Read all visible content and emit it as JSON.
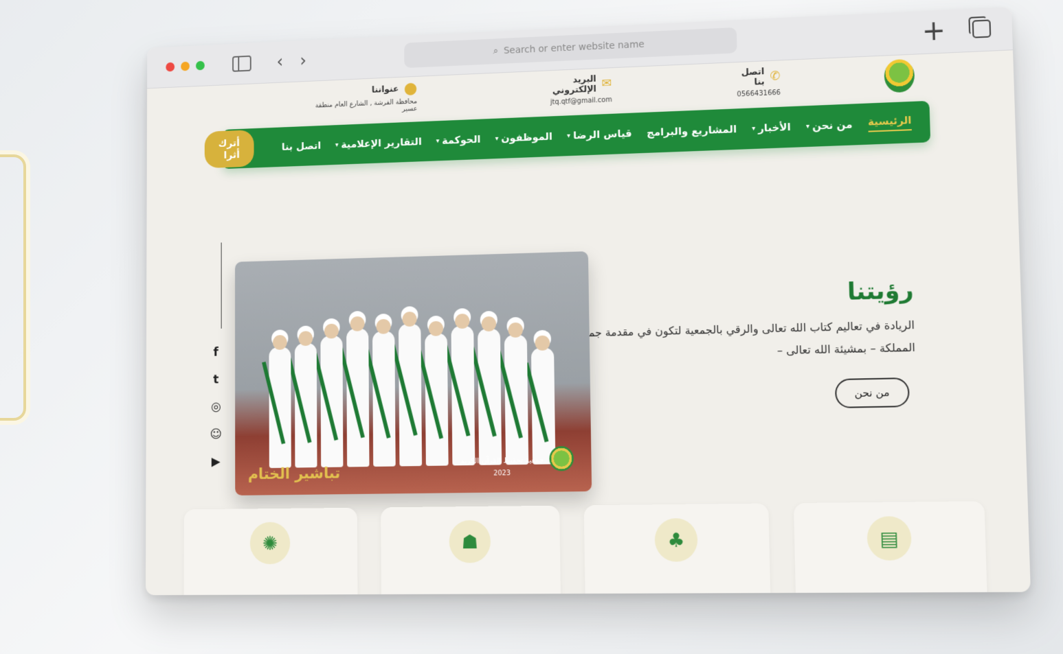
{
  "browser": {
    "address_placeholder": "Search or enter website name"
  },
  "topbar": {
    "address_label": "عنواننا",
    "address_value": "محافظة الفرشة , الشارع العام منطقة عسير",
    "email_label": "البريد الإلكتروني",
    "email_value": "jtq.qtf@gmail.com",
    "phone_label": "اتصل بنا",
    "phone_value": "0566431666"
  },
  "nav": {
    "items": [
      {
        "label": "الرئيسية"
      },
      {
        "label": "من نحن"
      },
      {
        "label": "الأخبار"
      },
      {
        "label": "المشاريع والبرامج"
      },
      {
        "label": "قياس الرضا"
      },
      {
        "label": "الموظفون"
      },
      {
        "label": "الحوكمة"
      },
      {
        "label": "التقارير الإعلامية"
      },
      {
        "label": "اتصل بنا"
      }
    ],
    "cta": "أترك أثرا"
  },
  "hero": {
    "title": "رؤيتنا",
    "text": "الريادة في تعاليم كتاب الله تعالى والرقي بالجمعية لتكون في مقدمة جمعيات المملكة – بمشيئة الله تعالى –",
    "button": "من نحن",
    "photo_caption": "تباشير الختام",
    "photo_association": "جمعية تحفيظ القرآن الكريم",
    "photo_year": "2023"
  },
  "social": {
    "facebook": "f",
    "twitter": "t",
    "instagram": "◎",
    "snapchat": "☺",
    "youtube": "▶"
  },
  "cards": [
    {
      "icon": "seal-icon"
    },
    {
      "icon": "reading-person-icon"
    },
    {
      "icon": "sprout-icon"
    },
    {
      "icon": "open-book-icon"
    }
  ],
  "colors": {
    "brand_green": "#1f8a3a",
    "accent_gold": "#d7b23c",
    "page_bg": "#f1efea"
  }
}
